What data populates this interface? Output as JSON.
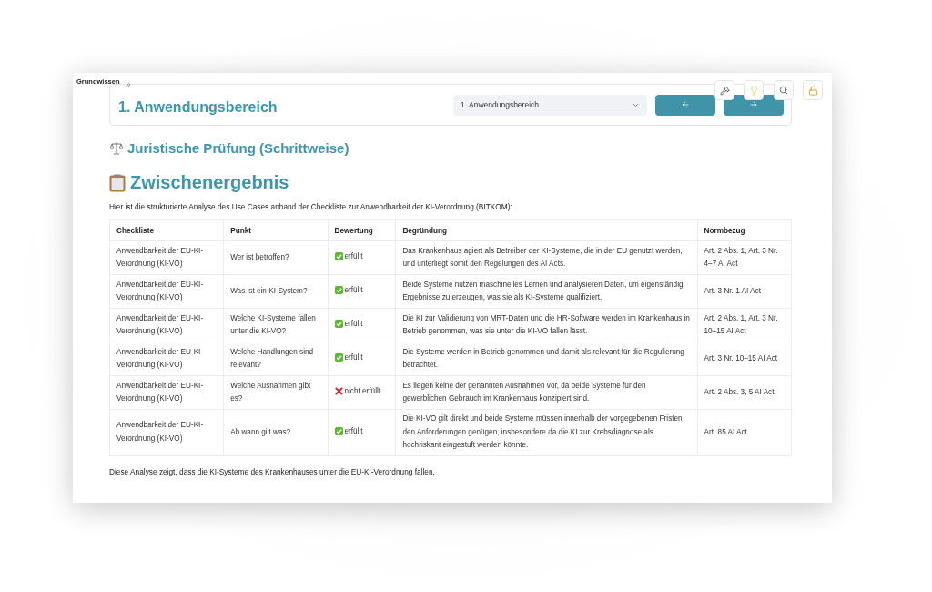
{
  "sidebar_label": "Grundwissen",
  "collapse_toggle": "»",
  "header": {
    "title": "1. Anwendungsbereich",
    "select_value": "1. Anwendungsbereich"
  },
  "section_title": "Juristische Prüfung (Schrittweise)",
  "result_title": "Zwischenergebnis",
  "intro": "Hier ist die strukturierte Analyse des Use Cases anhand der Checkliste zur Anwendbarkeit der KI-Verordnung (BITKOM):",
  "table": {
    "columns": [
      "Checkliste",
      "Punkt",
      "Bewertung",
      "Begründung",
      "Normbezug"
    ],
    "rows": [
      {
        "checkliste": "Anwendbarkeit der EU-KI-Verordnung (KI-VO)",
        "punkt": "Wer ist betroffen?",
        "kind": "pass",
        "bewertung": "erfüllt",
        "begruendung": "Das Krankenhaus agiert als Betreiber der KI-Systeme, die in der EU genutzt werden, und unterliegt somit den Regelungen des AI Acts.",
        "normbezug": "Art. 2 Abs. 1, Art. 3 Nr. 4–7 AI Act"
      },
      {
        "checkliste": "Anwendbarkeit der EU-KI-Verordnung (KI-VO)",
        "punkt": "Was ist ein KI-System?",
        "kind": "pass",
        "bewertung": "erfüllt",
        "begruendung": "Beide Systeme nutzen maschinelles Lernen und analysieren Daten, um eigenständig Ergebnisse zu erzeugen, was sie als KI-Systeme qualifiziert.",
        "normbezug": "Art. 3 Nr. 1 AI Act"
      },
      {
        "checkliste": "Anwendbarkeit der EU-KI-Verordnung (KI-VO)",
        "punkt": "Welche KI-Systeme fallen unter die KI-VO?",
        "kind": "pass",
        "bewertung": "erfüllt",
        "begruendung": "Die KI zur Validierung von MRT-Daten und die HR-Software werden im Krankenhaus in Betrieb genommen, was sie unter die KI-VO fallen lässt.",
        "normbezug": "Art. 2 Abs. 1, Art. 3 Nr. 10–15 AI Act"
      },
      {
        "checkliste": "Anwendbarkeit der EU-KI-Verordnung (KI-VO)",
        "punkt": "Welche Handlungen sind relevant?",
        "kind": "pass",
        "bewertung": "erfüllt",
        "begruendung": "Die Systeme werden in Betrieb genommen und damit als relevant für die Regulierung betrachtet.",
        "normbezug": "Art. 3 Nr. 10–15 AI Act"
      },
      {
        "checkliste": "Anwendbarkeit der EU-KI-Verordnung (KI-VO)",
        "punkt": "Welche Ausnahmen gibt es?",
        "kind": "fail",
        "bewertung": "nicht erfüllt",
        "begruendung": "Es liegen keine der genannten Ausnahmen vor, da beide Systeme für den gewerblichen Gebrauch im Krankenhaus konzipiert sind.",
        "normbezug": "Art. 2 Abs. 3, 5 AI Act"
      },
      {
        "checkliste": "Anwendbarkeit der EU-KI-Verordnung (KI-VO)",
        "punkt": "Ab wann gilt was?",
        "kind": "pass",
        "bewertung": "erfüllt",
        "begruendung": "Die KI-VO gilt direkt und beide Systeme müssen innerhalb der vorgegebenen Fristen den Anforderungen genügen, insbesondere da die KI zur Krebsdiagnose als hochriskant eingestuft werden könnte.",
        "normbezug": "Art. 85 AI Act"
      }
    ]
  },
  "conclusion": "Diese Analyse zeigt, dass die KI-Systeme des Krankenhauses unter die EU-KI-Verordnung fallen,"
}
